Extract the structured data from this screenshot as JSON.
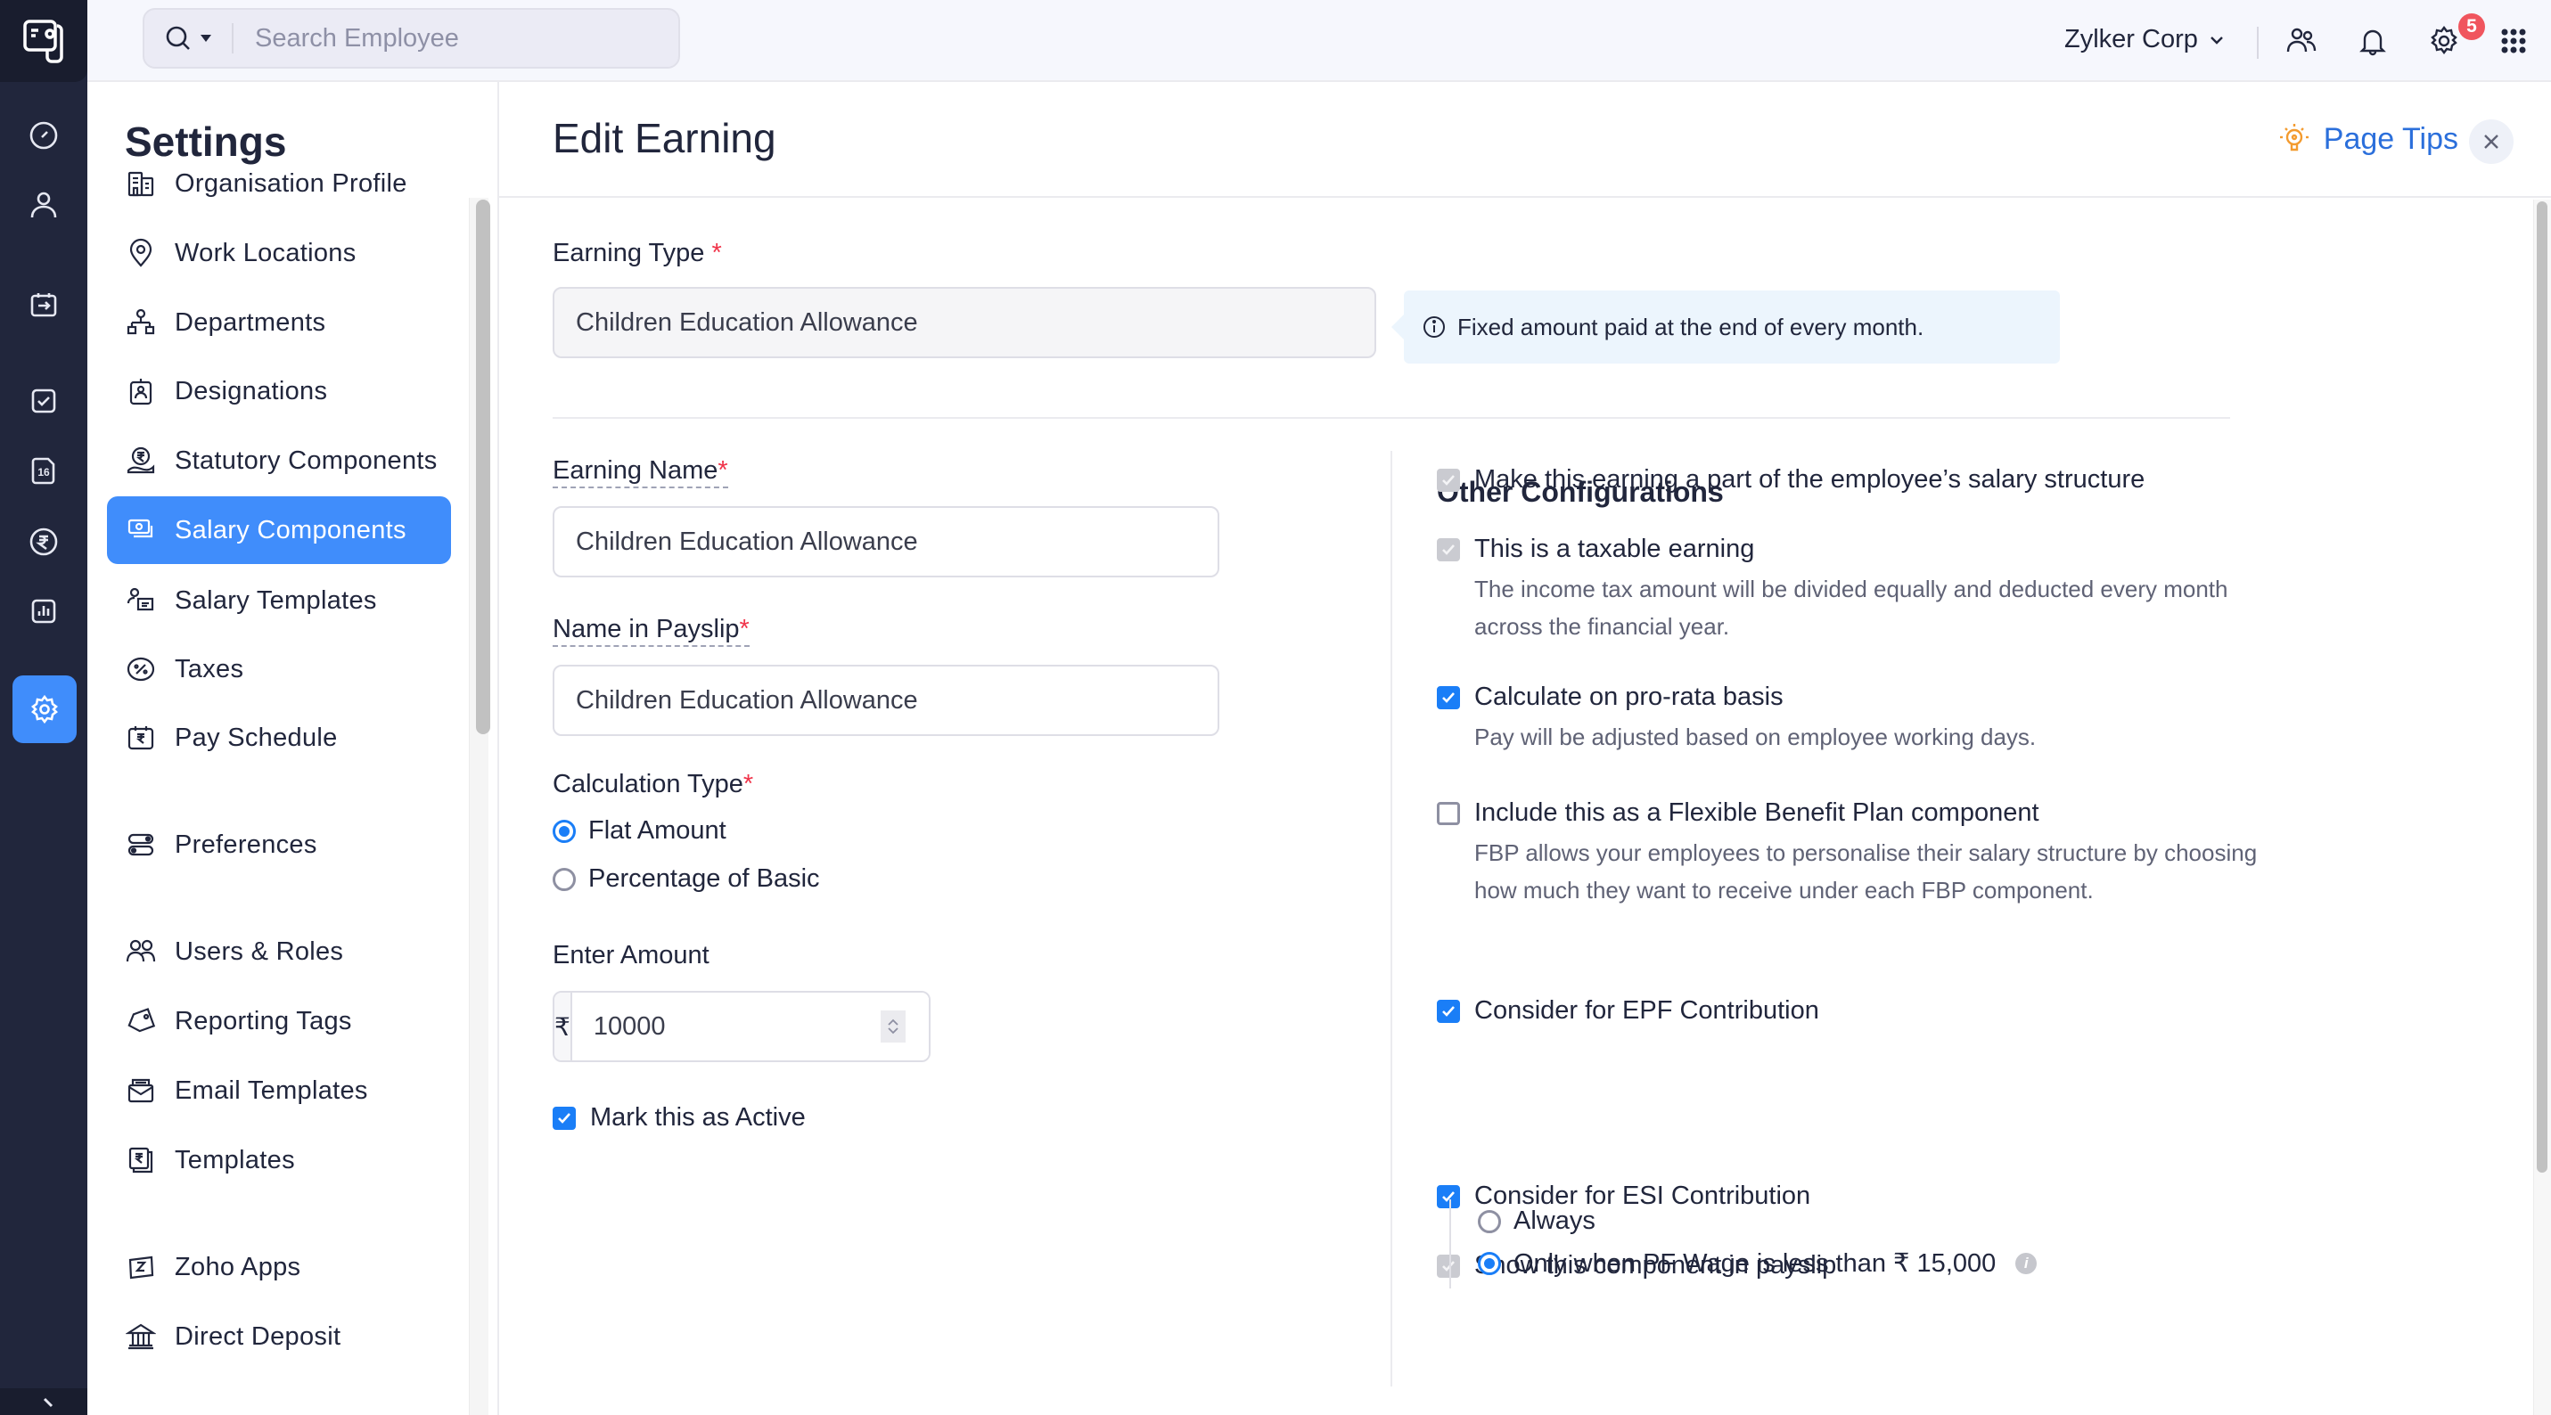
{
  "rail": {
    "items": [
      {
        "name": "dashboard-icon"
      },
      {
        "name": "employees-icon"
      },
      {
        "name": "pay-runs-icon"
      },
      {
        "name": "approvals-icon"
      },
      {
        "name": "form16-icon",
        "text": "16"
      },
      {
        "name": "loans-icon"
      },
      {
        "name": "reports-icon"
      },
      {
        "name": "settings-icon",
        "active": true
      }
    ]
  },
  "topbar": {
    "search_placeholder": "Search Employee",
    "org_name": "Zylker Corp",
    "notification_count": "5"
  },
  "sidebar": {
    "title": "Settings",
    "items": [
      {
        "label": "Organisation Profile",
        "icon": "building-icon"
      },
      {
        "label": "Work Locations",
        "icon": "location-pin-icon"
      },
      {
        "label": "Departments",
        "icon": "org-chart-icon"
      },
      {
        "label": "Designations",
        "icon": "id-badge-icon"
      },
      {
        "label": "Statutory Components",
        "icon": "rupee-hand-icon"
      },
      {
        "label": "Salary Components",
        "icon": "money-icon",
        "active": true
      },
      {
        "label": "Salary Templates",
        "icon": "user-template-icon"
      },
      {
        "label": "Taxes",
        "icon": "percent-icon"
      },
      {
        "label": "Pay Schedule",
        "icon": "calendar-rupee-icon"
      },
      {
        "label": "Preferences",
        "icon": "toggle-icon"
      },
      {
        "label": "Users & Roles",
        "icon": "users-icon"
      },
      {
        "label": "Reporting Tags",
        "icon": "tag-icon"
      },
      {
        "label": "Email Templates",
        "icon": "email-icon"
      },
      {
        "label": "Templates",
        "icon": "rupee-doc-icon"
      },
      {
        "label": "Zoho Apps",
        "icon": "zoho-icon"
      },
      {
        "label": "Direct Deposit",
        "icon": "bank-icon"
      }
    ]
  },
  "main": {
    "title": "Edit Earning",
    "page_tips": "Page Tips",
    "earning_type": {
      "label": "Earning Type",
      "required": "*",
      "value": "Children Education Allowance",
      "info": "Fixed amount paid at the end of every month."
    },
    "earning_name": {
      "label": "Earning Name",
      "required": "*",
      "value": "Children Education Allowance"
    },
    "name_in_payslip": {
      "label": "Name in Payslip",
      "required": "*",
      "value": "Children Education Allowance"
    },
    "calculation_type": {
      "label": "Calculation Type",
      "required": "*",
      "options": [
        {
          "label": "Flat Amount",
          "selected": true
        },
        {
          "label": "Percentage of Basic",
          "selected": false
        }
      ]
    },
    "amount": {
      "label": "Enter Amount",
      "currency": "₹",
      "value": "10000"
    },
    "mark_active": {
      "label": "Mark this as Active",
      "checked": true
    },
    "other": {
      "title": "Other Configurations",
      "options": [
        {
          "label": "Make this earning a part of the employee’s salary structure",
          "state": "disabled-checked"
        },
        {
          "label": "This is a taxable earning",
          "state": "disabled-checked",
          "desc": "The income tax amount will be divided equally and deducted every month across the financial year."
        },
        {
          "label": "Calculate on pro-rata basis",
          "state": "checked",
          "desc": "Pay will be adjusted based on employee working days."
        },
        {
          "label": "Include this as a Flexible Benefit Plan component",
          "state": "unchecked",
          "desc": "FBP allows your employees to personalise their salary structure by choosing how much they want to receive under each FBP component."
        },
        {
          "label": "Consider for EPF Contribution",
          "state": "checked"
        },
        {
          "label": "Consider for ESI Contribution",
          "state": "checked"
        },
        {
          "label": "Show this component in payslip",
          "state": "disabled-checked"
        }
      ],
      "epf_options": [
        {
          "label": "Always",
          "selected": false
        },
        {
          "label": "Only when PF Wage is less than ₹ 15,000",
          "selected": true
        }
      ]
    }
  }
}
